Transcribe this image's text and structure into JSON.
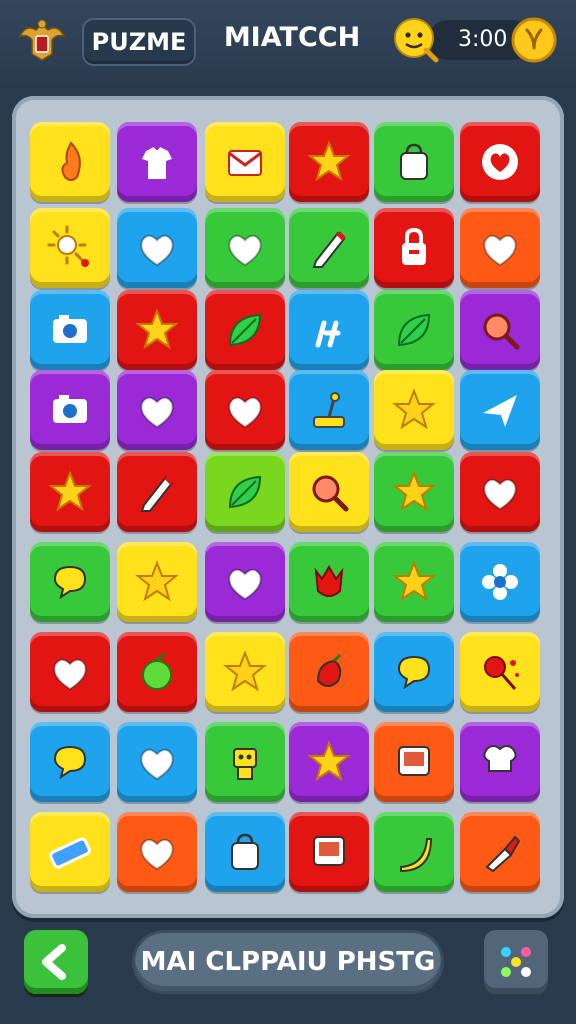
{
  "header": {
    "left_label": "PUZME",
    "title": "MIATCCH",
    "timer": "3:00"
  },
  "colors": {
    "yellow": "#ffe21b",
    "purple": "#9a29d6",
    "red": "#e31512",
    "green": "#37c93a",
    "lime": "#7ad71f",
    "blue": "#1fa3ec",
    "orange": "#ff5a15"
  },
  "board": {
    "rows": [
      [
        {
          "c": "yellow",
          "i": "flame-icon"
        },
        {
          "c": "purple",
          "i": "shirt-icon"
        },
        {
          "c": "yellow",
          "i": "envelope-icon"
        },
        {
          "c": "red",
          "i": "star-icon"
        },
        {
          "c": "green",
          "i": "bag-icon"
        },
        {
          "c": "red",
          "i": "heart-badge-icon"
        }
      ],
      [
        {
          "c": "yellow",
          "i": "sun-icon"
        },
        {
          "c": "blue",
          "i": "heart-icon"
        },
        {
          "c": "green",
          "i": "heart-icon"
        },
        {
          "c": "green",
          "i": "pencil-icon"
        },
        {
          "c": "red",
          "i": "lock-icon"
        },
        {
          "c": "orange",
          "i": "heart-icon"
        }
      ],
      [
        {
          "c": "blue",
          "i": "camera-icon"
        },
        {
          "c": "red",
          "i": "star-icon"
        },
        {
          "c": "red",
          "i": "leaf-icon"
        },
        {
          "c": "blue",
          "i": "tool-icon"
        },
        {
          "c": "green",
          "i": "leaf-icon"
        },
        {
          "c": "purple",
          "i": "magnifier-icon"
        }
      ],
      [
        {
          "c": "purple",
          "i": "camera-icon"
        },
        {
          "c": "purple",
          "i": "heart-icon"
        },
        {
          "c": "red",
          "i": "heart-icon"
        },
        {
          "c": "blue",
          "i": "joystick-icon"
        },
        {
          "c": "yellow",
          "i": "star-icon"
        },
        {
          "c": "blue",
          "i": "plane-icon"
        }
      ],
      [
        {
          "c": "red",
          "i": "star-icon"
        },
        {
          "c": "red",
          "i": "pencil-icon"
        },
        {
          "c": "lime",
          "i": "leaf-icon"
        },
        {
          "c": "yellow",
          "i": "magnifier-icon"
        },
        {
          "c": "green",
          "i": "star-icon"
        },
        {
          "c": "red",
          "i": "heart-icon"
        }
      ],
      [
        {
          "c": "green",
          "i": "bubble-icon"
        },
        {
          "c": "yellow",
          "i": "star-icon"
        },
        {
          "c": "purple",
          "i": "heart-icon"
        },
        {
          "c": "green",
          "i": "tulip-icon"
        },
        {
          "c": "green",
          "i": "star-icon"
        },
        {
          "c": "blue",
          "i": "flower-icon"
        }
      ],
      [
        {
          "c": "red",
          "i": "heart-icon"
        },
        {
          "c": "red",
          "i": "apple-icon"
        },
        {
          "c": "yellow",
          "i": "star-icon"
        },
        {
          "c": "orange",
          "i": "pepper-icon"
        },
        {
          "c": "blue",
          "i": "bubble-icon"
        },
        {
          "c": "yellow",
          "i": "lollipop-icon"
        }
      ],
      [
        {
          "c": "blue",
          "i": "bubble-icon"
        },
        {
          "c": "blue",
          "i": "heart-icon"
        },
        {
          "c": "green",
          "i": "robot-icon"
        },
        {
          "c": "purple",
          "i": "star-icon"
        },
        {
          "c": "orange",
          "i": "tv-icon"
        },
        {
          "c": "purple",
          "i": "chef-hat-icon"
        }
      ],
      [
        {
          "c": "yellow",
          "i": "ticket-icon"
        },
        {
          "c": "orange",
          "i": "heart-icon"
        },
        {
          "c": "blue",
          "i": "bag-icon"
        },
        {
          "c": "red",
          "i": "tv-icon"
        },
        {
          "c": "green",
          "i": "banana-icon"
        },
        {
          "c": "orange",
          "i": "brush-icon"
        }
      ]
    ]
  },
  "footer": {
    "action_label": "MAI CLPPAIU PHSTG"
  }
}
